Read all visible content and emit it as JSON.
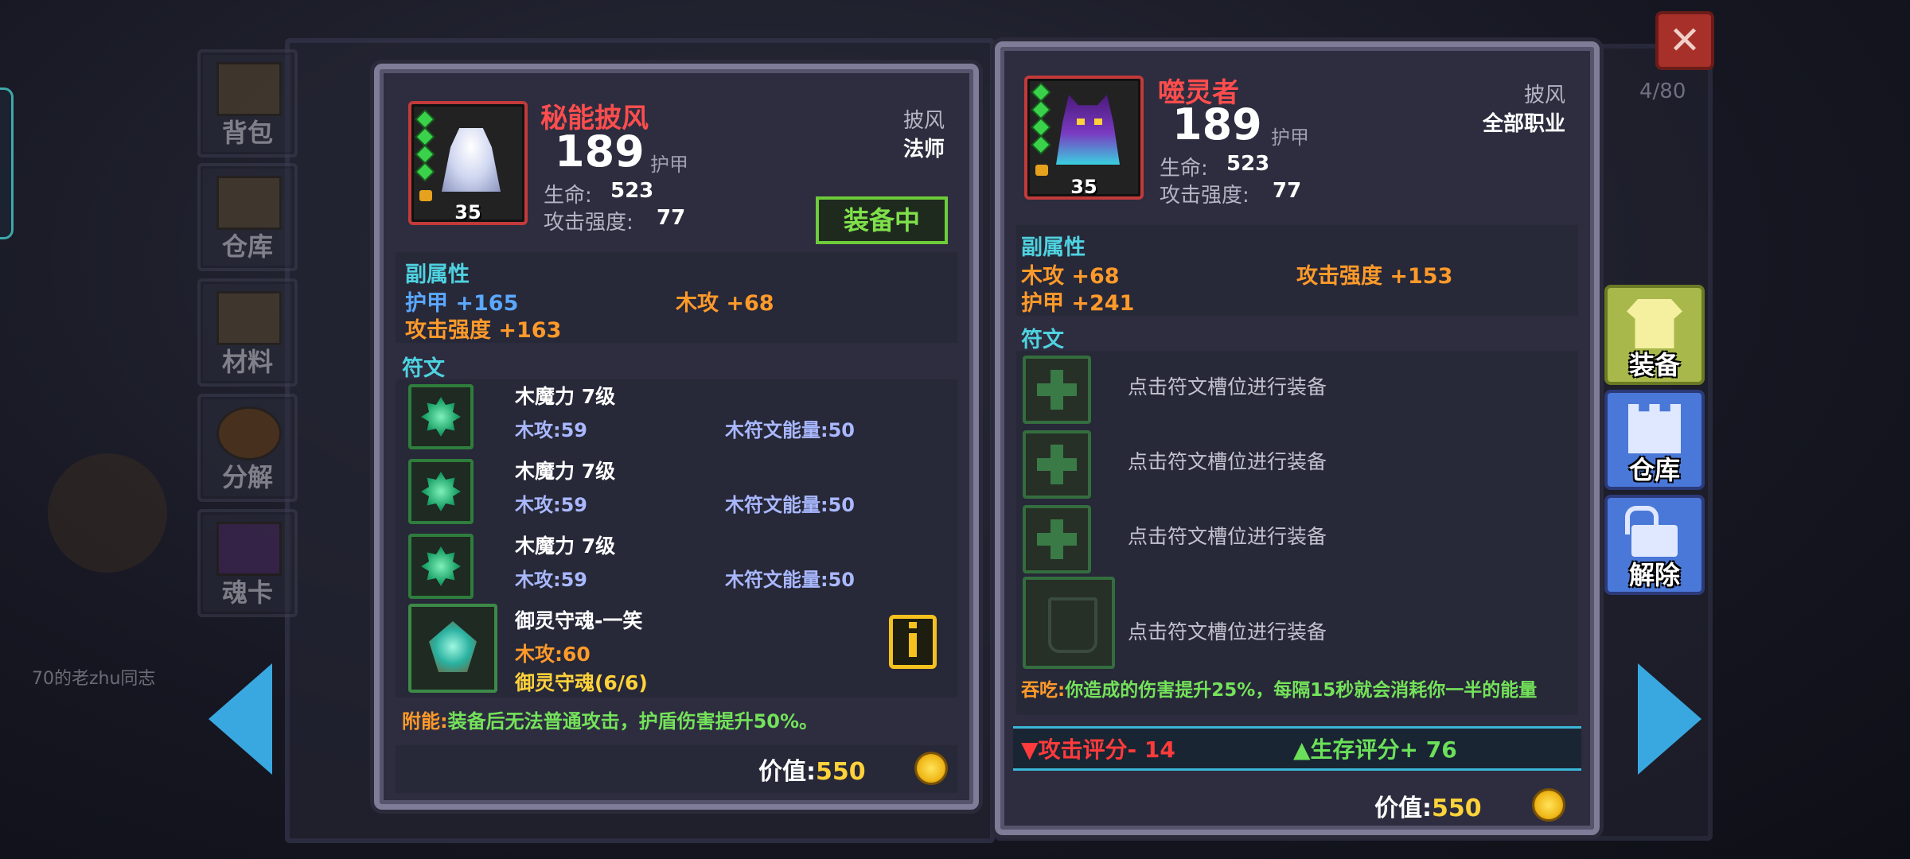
{
  "nav": {
    "items": [
      {
        "label": "背包"
      },
      {
        "label": "仓库"
      },
      {
        "label": "材料"
      },
      {
        "label": "分解"
      },
      {
        "label": "魂卡"
      }
    ]
  },
  "background_chat": "70的老zhu同志",
  "page_count": "4/80",
  "equipped_card": {
    "name": "秘能披风",
    "level": "35",
    "value": "189",
    "value_unit": "护甲",
    "category": "披风",
    "class": "法师",
    "life_label": "生命:",
    "life_value": "523",
    "atk_label": "攻击强度:",
    "atk_value": "77",
    "equipped_badge": "装备中",
    "sub_title": "副属性",
    "sub_stats": [
      "护甲 +165",
      "木攻 +68",
      "攻击强度 +163"
    ],
    "rune_title": "符文",
    "runes": [
      {
        "name": "木魔力 7级",
        "stat": "木攻:59",
        "energy": "木符文能量:50"
      },
      {
        "name": "木魔力 7级",
        "stat": "木攻:59",
        "energy": "木符文能量:50"
      },
      {
        "name": "木魔力 7级",
        "stat": "木攻:59",
        "energy": "木符文能量:50"
      }
    ],
    "soul": {
      "name": "御灵守魂-一笑",
      "stat": "木攻:60",
      "set": "御灵守魂(6/6)"
    },
    "enchant_label": "附能:",
    "enchant_text": "装备后无法普通攻击，护盾伤害提升50%。",
    "price_label": "价值:",
    "price": "550"
  },
  "compare_card": {
    "name": "噬灵者",
    "level": "35",
    "value": "189",
    "value_unit": "护甲",
    "category": "披风",
    "class": "全部职业",
    "life_label": "生命:",
    "life_value": "523",
    "atk_label": "攻击强度:",
    "atk_value": "77",
    "sub_title": "副属性",
    "sub_stats": [
      "木攻 +68",
      "攻击强度 +153",
      "护甲 +241"
    ],
    "rune_title": "符文",
    "slot_hint": "点击符文槽位进行装备",
    "devour_label": "吞吃:",
    "devour_text": "你造成的伤害提升25%，每隔15秒就会消耗你一半的能量",
    "attack_score": "攻击评分- 14",
    "survive_score": "生存评分+ 76",
    "price_label": "价值:",
    "price": "550"
  },
  "side_buttons": [
    {
      "label": "装备"
    },
    {
      "label": "仓库"
    },
    {
      "label": "解除"
    }
  ],
  "close_icon": "close-icon",
  "colors": {
    "accent_red": "#ff4d4d",
    "orange": "#ff9a2a",
    "cyan": "#4fd2e0",
    "green": "#74e25a",
    "gold": "#ffd23a"
  }
}
